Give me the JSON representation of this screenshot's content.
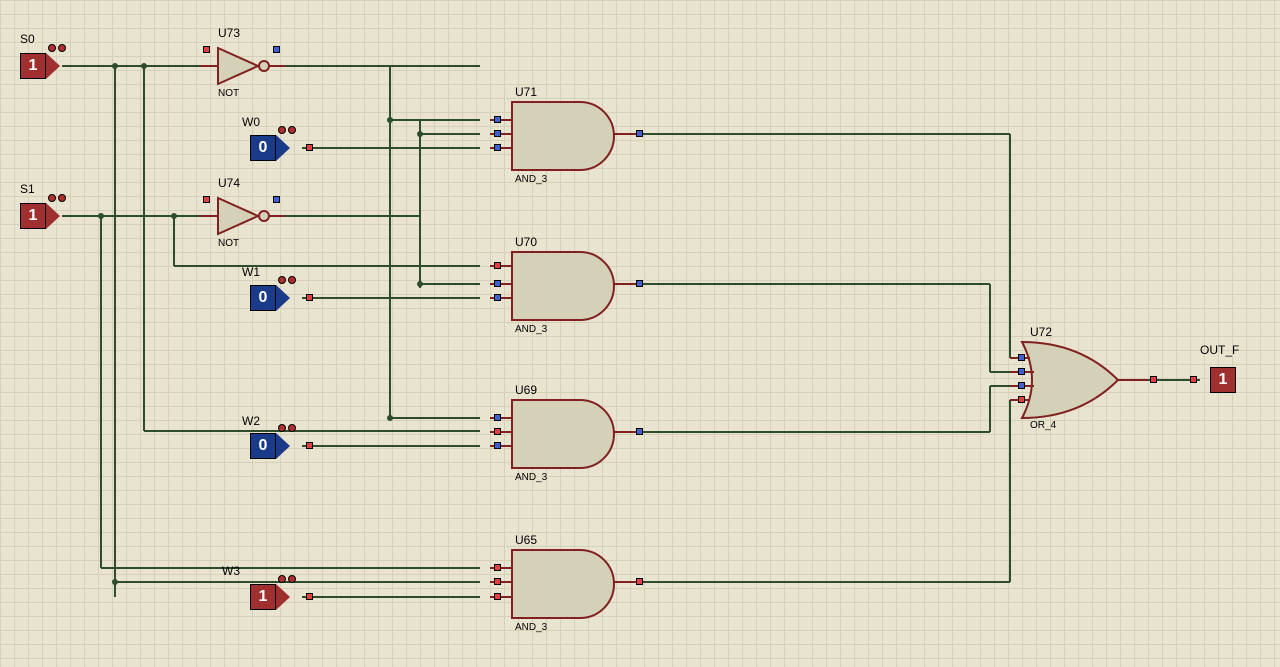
{
  "inputs": {
    "S0": {
      "label": "S0",
      "value": "1",
      "state": "high"
    },
    "S1": {
      "label": "S1",
      "value": "1",
      "state": "high"
    },
    "W0": {
      "label": "W0",
      "value": "0",
      "state": "low"
    },
    "W1": {
      "label": "W1",
      "value": "0",
      "state": "low"
    },
    "W2": {
      "label": "W2",
      "value": "0",
      "state": "low"
    },
    "W3": {
      "label": "W3",
      "value": "1",
      "state": "high"
    }
  },
  "output": {
    "OUT_F": {
      "label": "OUT_F",
      "value": "1",
      "state": "high"
    }
  },
  "gates": {
    "U73": {
      "ref": "U73",
      "type": "NOT"
    },
    "U74": {
      "ref": "U74",
      "type": "NOT"
    },
    "U71": {
      "ref": "U71",
      "type": "AND_3"
    },
    "U70": {
      "ref": "U70",
      "type": "AND_3"
    },
    "U69": {
      "ref": "U69",
      "type": "AND_3"
    },
    "U65": {
      "ref": "U65",
      "type": "AND_3"
    },
    "U72": {
      "ref": "U72",
      "type": "OR_4"
    }
  },
  "chart_data": {
    "type": "table",
    "description": "4-to-1 multiplexer schematic built from gates",
    "inputs": [
      {
        "name": "S0",
        "value": 1
      },
      {
        "name": "S1",
        "value": 1
      },
      {
        "name": "W0",
        "value": 0
      },
      {
        "name": "W1",
        "value": 0
      },
      {
        "name": "W2",
        "value": 0
      },
      {
        "name": "W3",
        "value": 1
      }
    ],
    "gates": [
      {
        "ref": "U73",
        "type": "NOT",
        "inputs": [
          "S0"
        ],
        "output_state": 0
      },
      {
        "ref": "U74",
        "type": "NOT",
        "inputs": [
          "S1"
        ],
        "output_state": 0
      },
      {
        "ref": "U71",
        "type": "AND_3",
        "inputs": [
          "NOT S0",
          "NOT S1",
          "W0"
        ],
        "output_state": 0
      },
      {
        "ref": "U70",
        "type": "AND_3",
        "inputs": [
          "S0",
          "NOT S1",
          "W1"
        ],
        "output_state": 0
      },
      {
        "ref": "U69",
        "type": "AND_3",
        "inputs": [
          "NOT S0",
          "S1",
          "W2"
        ],
        "output_state": 0
      },
      {
        "ref": "U65",
        "type": "AND_3",
        "inputs": [
          "S0",
          "S1",
          "W3"
        ],
        "output_state": 1
      },
      {
        "ref": "U72",
        "type": "OR_4",
        "inputs": [
          "U71",
          "U70",
          "U69",
          "U65"
        ],
        "output_state": 1
      }
    ],
    "output": {
      "name": "OUT_F",
      "value": 1
    }
  }
}
